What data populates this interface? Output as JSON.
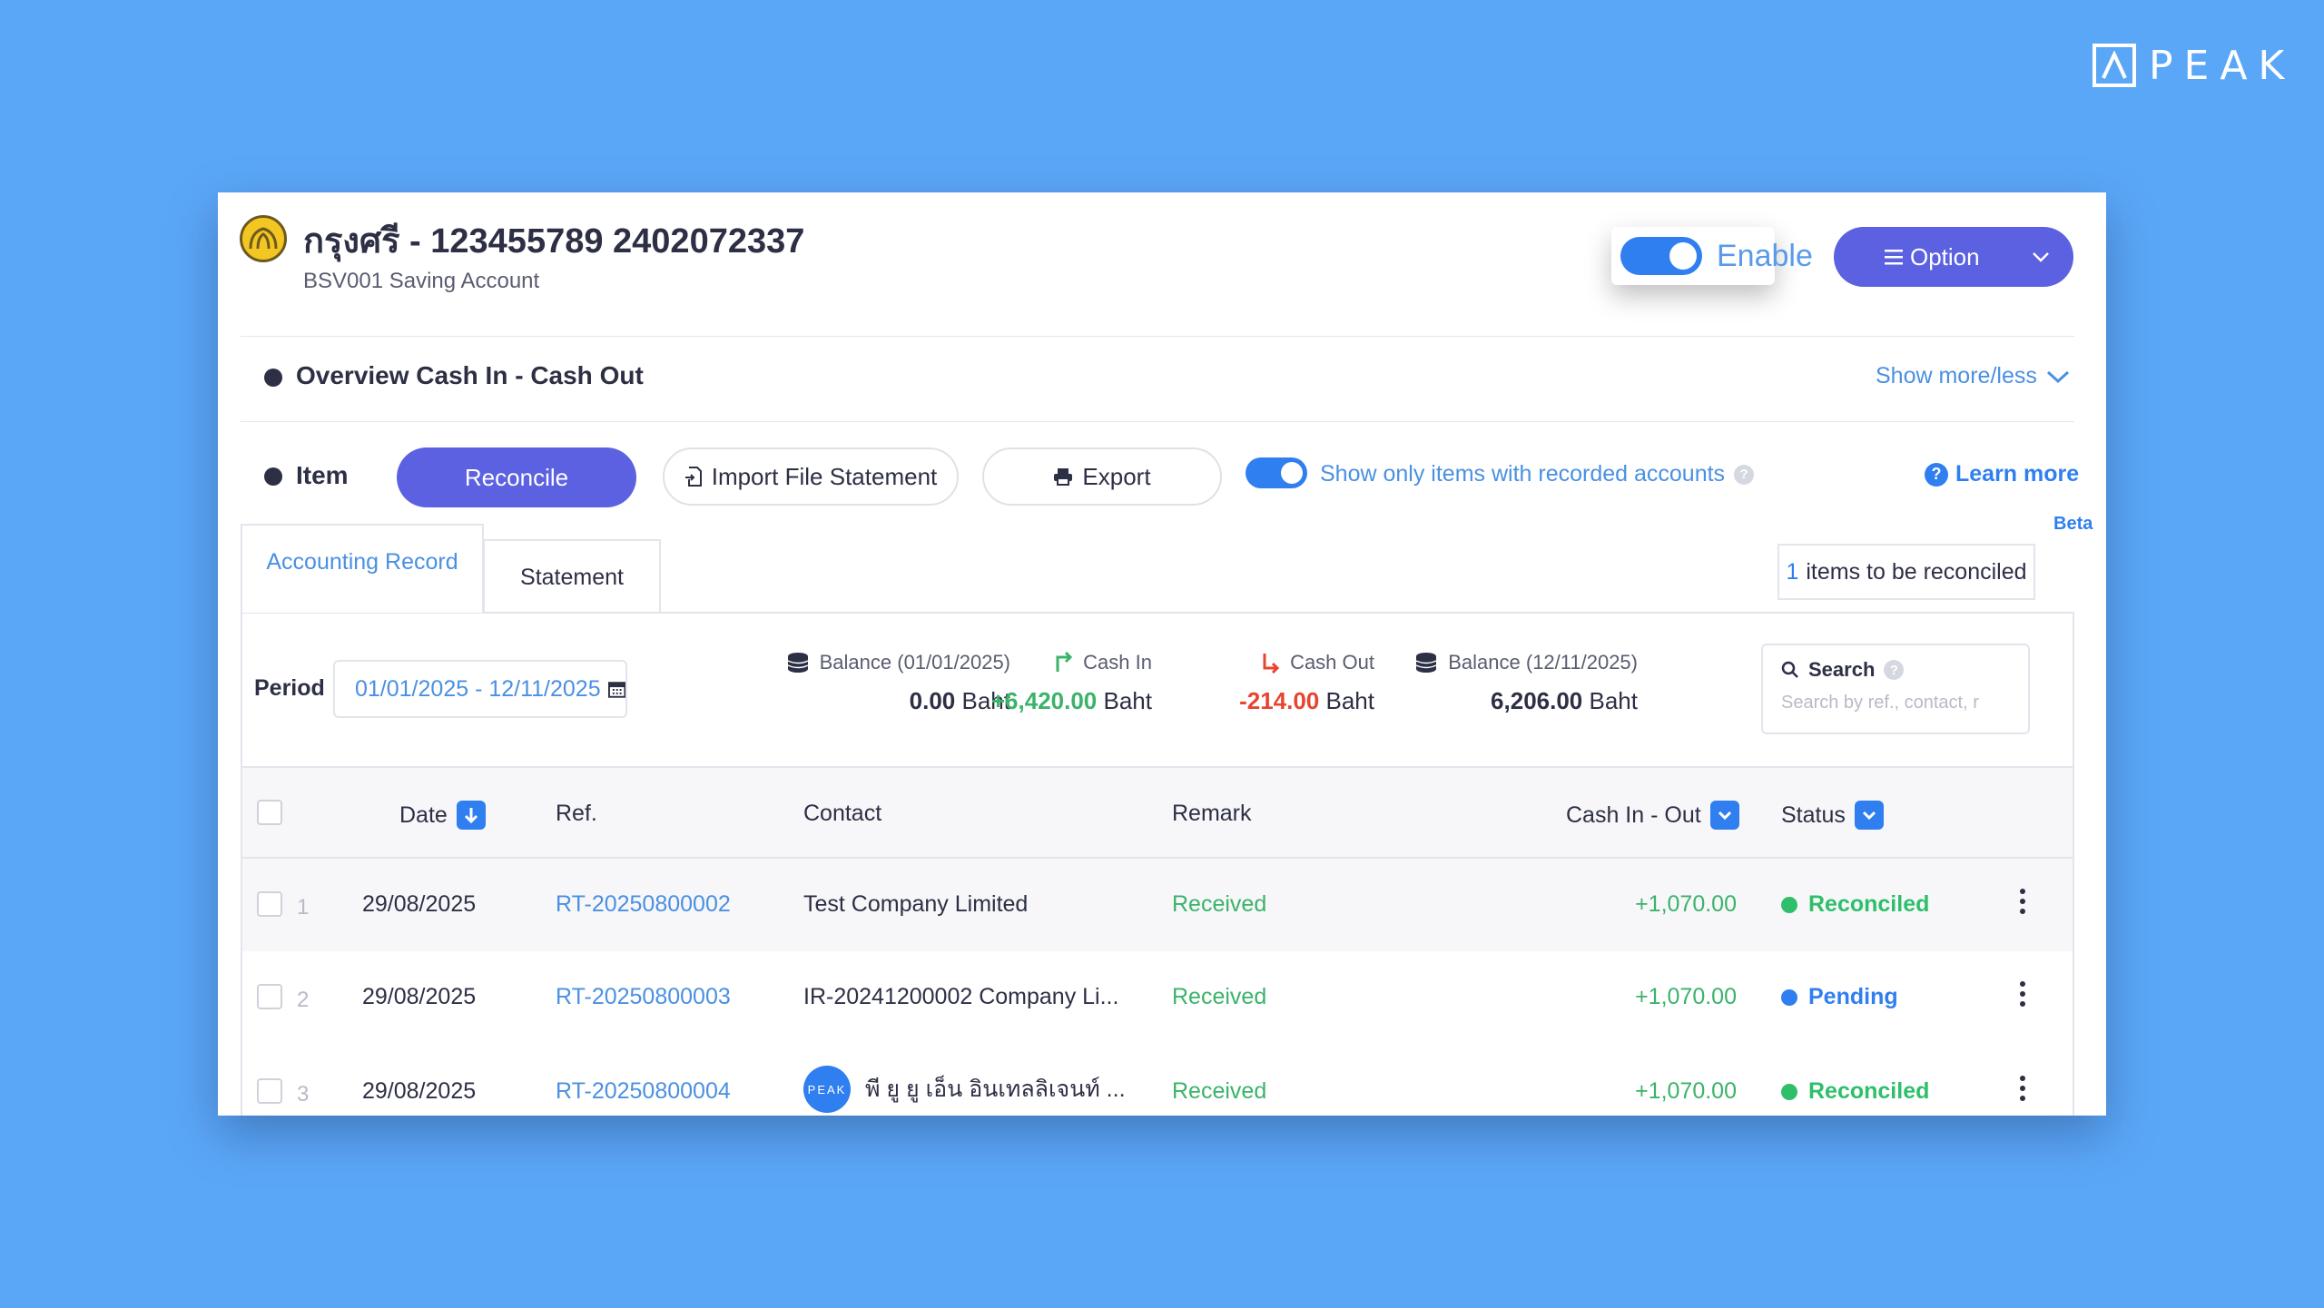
{
  "brand": {
    "name": "PEAK"
  },
  "header": {
    "account_title": "กรุงศรี - 123455789 2402072337",
    "account_subtitle": "BSV001 Saving Account",
    "enable_label": "Enable",
    "enable_on": true,
    "option_label": "Option"
  },
  "overview": {
    "title": "Overview Cash In - Cash Out",
    "show_more": "Show more/less"
  },
  "items_bar": {
    "label": "Item",
    "reconcile": "Reconcile",
    "import": "Import File Statement",
    "export": "Export",
    "recorded_only": "Show only items with recorded accounts",
    "recorded_only_on": true,
    "learn_more": "Learn more",
    "beta": "Beta"
  },
  "tabs": [
    {
      "label": "Accounting Record",
      "active": true
    },
    {
      "label": "Statement",
      "active": false
    }
  ],
  "badge": {
    "count": "1",
    "text": "items to be reconciled"
  },
  "period": {
    "label": "Period",
    "value": "01/01/2025 - 12/11/2025"
  },
  "stats": {
    "balance_start": {
      "label": "Balance (01/01/2025)",
      "value": "0.00",
      "unit": "Baht"
    },
    "cash_in": {
      "label": "Cash In",
      "value": "+6,420.00",
      "unit": "Baht"
    },
    "cash_out": {
      "label": "Cash Out",
      "value": "-214.00",
      "unit": "Baht"
    },
    "balance_end": {
      "label": "Balance (12/11/2025)",
      "value": "6,206.00",
      "unit": "Baht"
    }
  },
  "search": {
    "label": "Search",
    "placeholder": "Search by ref., contact, r"
  },
  "table": {
    "columns": {
      "date": "Date",
      "ref": "Ref.",
      "contact": "Contact",
      "remark": "Remark",
      "cash": "Cash In - Out",
      "status": "Status"
    },
    "rows": [
      {
        "index": "1",
        "date": "29/08/2025",
        "ref": "RT-20250800002",
        "contact": "Test Company Limited",
        "remark": "Received",
        "amount": "+1,070.00",
        "status": "Reconciled",
        "status_color": "#2fbf6b"
      },
      {
        "index": "2",
        "date": "29/08/2025",
        "ref": "RT-20250800003",
        "contact": "IR-20241200002 Company Li...",
        "remark": "Received",
        "amount": "+1,070.00",
        "status": "Pending",
        "status_color": "#2f7ff0"
      },
      {
        "index": "3",
        "date": "29/08/2025",
        "ref": "RT-20250800004",
        "contact": "พี ยู ยู เอ็น อินเทลลิเจนท์ ...",
        "contact_avatar": "PEAK",
        "remark": "Received",
        "amount": "+1,070.00",
        "status": "Reconciled",
        "status_color": "#2fbf6b"
      }
    ]
  }
}
